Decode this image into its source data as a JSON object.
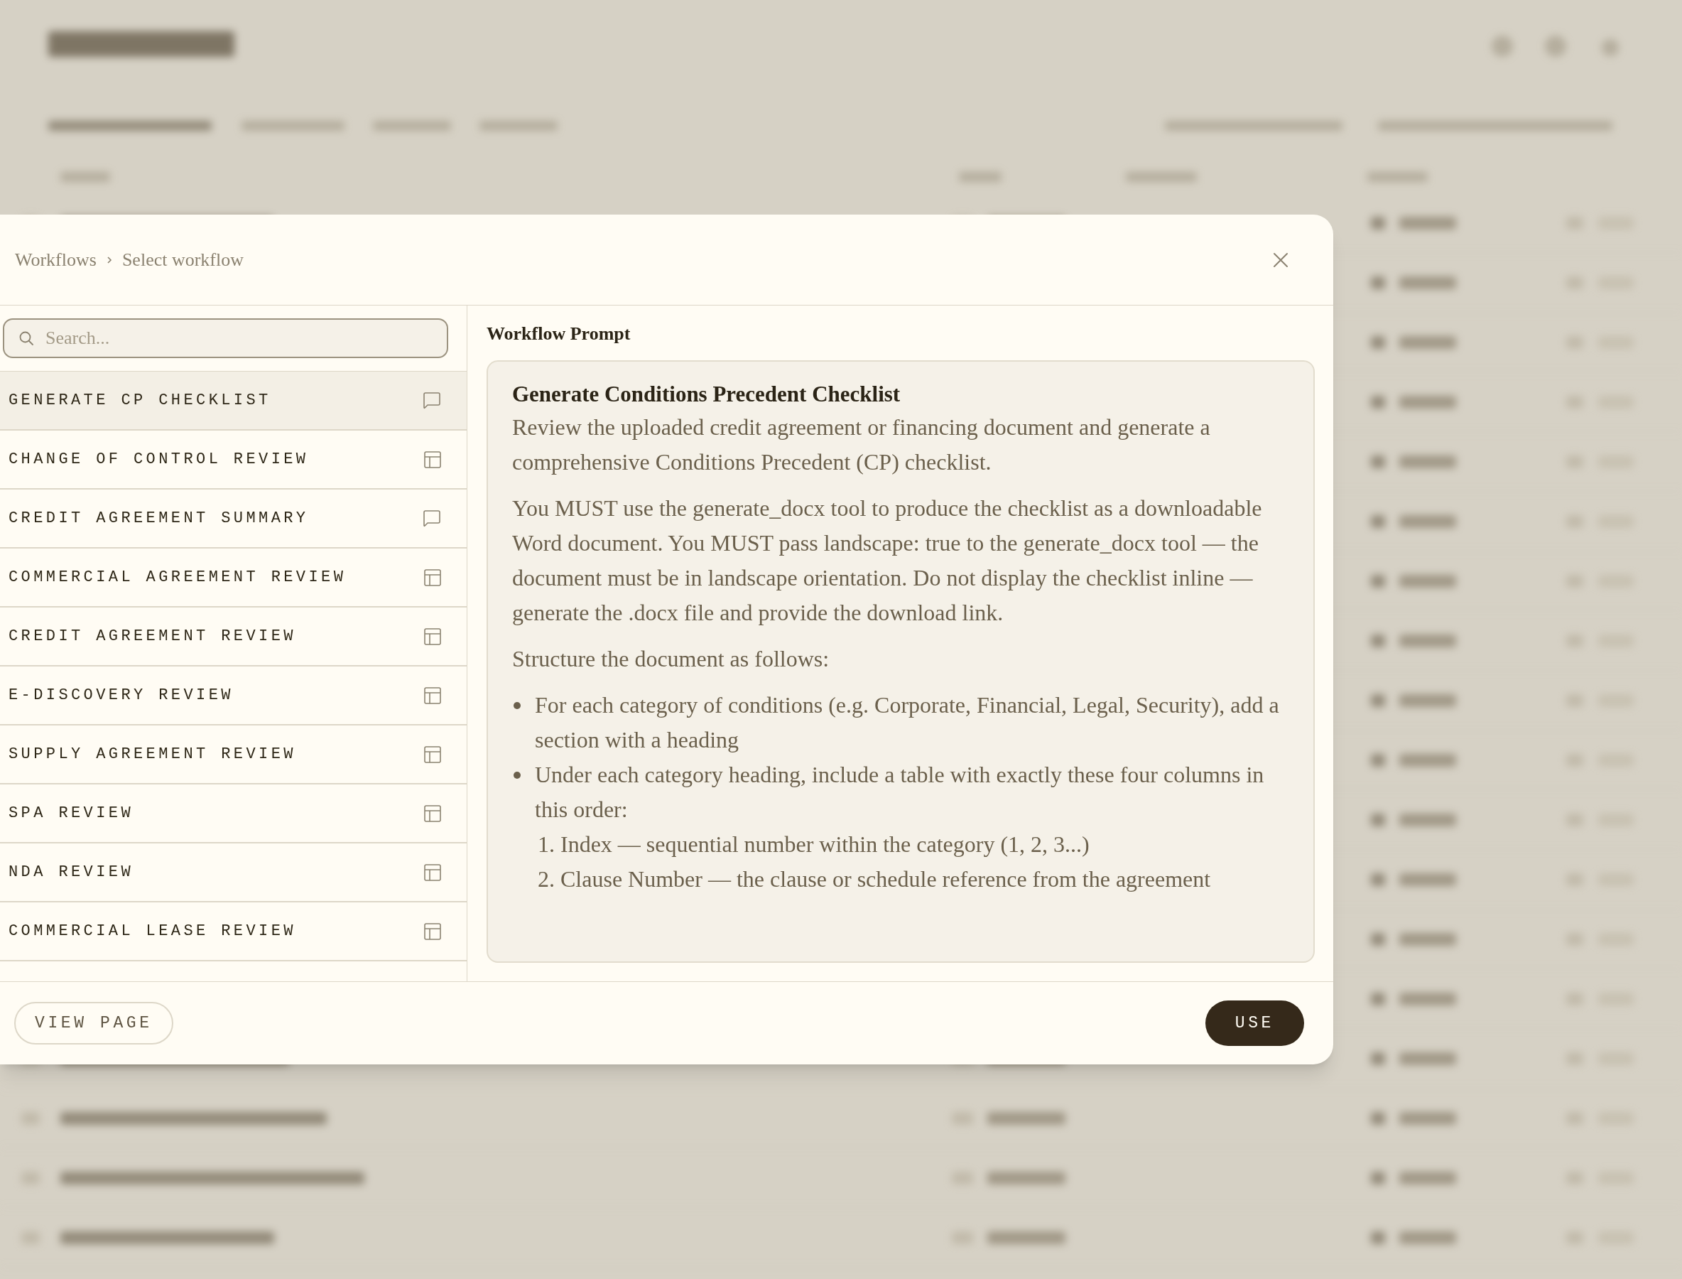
{
  "breadcrumb": [
    "Workflows",
    "Select workflow"
  ],
  "search": {
    "placeholder": "Search..."
  },
  "workflows": [
    {
      "label": "GENERATE CP CHECKLIST",
      "kind": "chat",
      "selected": true
    },
    {
      "label": "CHANGE OF CONTROL REVIEW",
      "kind": "table",
      "selected": false
    },
    {
      "label": "CREDIT AGREEMENT SUMMARY",
      "kind": "chat",
      "selected": false
    },
    {
      "label": "COMMERCIAL AGREEMENT REVIEW",
      "kind": "table",
      "selected": false
    },
    {
      "label": "CREDIT AGREEMENT REVIEW",
      "kind": "table",
      "selected": false
    },
    {
      "label": "E-DISCOVERY REVIEW",
      "kind": "table",
      "selected": false
    },
    {
      "label": "SUPPLY AGREEMENT REVIEW",
      "kind": "table",
      "selected": false
    },
    {
      "label": "SPA REVIEW",
      "kind": "table",
      "selected": false
    },
    {
      "label": "NDA REVIEW",
      "kind": "table",
      "selected": false
    },
    {
      "label": "COMMERCIAL LEASE REVIEW",
      "kind": "table",
      "selected": false
    }
  ],
  "prompt": {
    "label": "Workflow Prompt",
    "title": "Generate Conditions Precedent Checklist",
    "paragraphs": [
      "Review the uploaded credit agreement or financing document and generate a comprehensive Conditions Precedent (CP) checklist.",
      "You MUST use the generate_docx tool to produce the checklist as a downloadable Word document. You MUST pass landscape: true to the generate_docx tool — the document must be in landscape orientation. Do not display the checklist inline — generate the .docx file and provide the download link.",
      "Structure the document as follows:"
    ],
    "bullets": [
      {
        "text": "For each category of conditions (e.g. Corporate, Financial, Legal, Security), add a section with a heading"
      },
      {
        "text": "Under each category heading, include a table with exactly these four columns in this order:",
        "children": [
          {
            "marker": "1.",
            "text": "Index — sequential number within the category (1, 2, 3...)"
          },
          {
            "marker": "2.",
            "text": "Clause Number — the clause or schedule reference from the agreement"
          }
        ]
      }
    ]
  },
  "footer": {
    "view_page": "VIEW PAGE",
    "use": "USE"
  }
}
